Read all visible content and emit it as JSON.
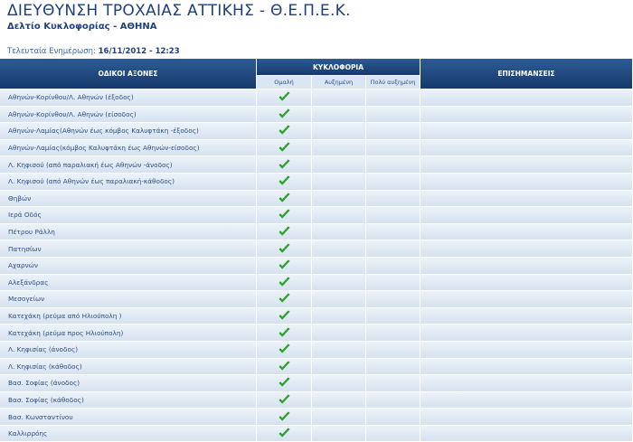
{
  "header": {
    "title": "ΔΙΕΥΘΥΝΣΗ ΤΡΟΧΑΙΑΣ ΑΤΤΙΚΗΣ - Θ.Ε.Π.Ε.Κ.",
    "subtitle": "Δελτίο Κυκλοφορίας - ΑΘΗΝΑ",
    "updated_label": "Τελευταία Ενημέρωση:",
    "updated_value": "16/11/2012 - 12:23"
  },
  "table": {
    "col_roads": "ΟΔΙΚΟΙ ΑΞΟΝΕΣ",
    "col_traffic": "ΚΥΚΛΟΦΟΡΙΑ",
    "col_notes": "ΕΠΙΣΗΜΑΝΣΕΙΣ",
    "traffic_levels": [
      "Ομαλή",
      "Αυξημένη",
      "Πολύ αυξημένη"
    ],
    "rows": [
      {
        "road": "Αθηνών-Κορίνθου/Λ. Αθηνών (έξοδος)",
        "status": "Ομαλή"
      },
      {
        "road": "Αθηνών-Κορίνθου/Λ. Αθηνών (είσοδος)",
        "status": "Ομαλή"
      },
      {
        "road": "Αθηνών-Λαμίας(Αθηνών έως κόμβος Καλυφτάκη -έξοδος)",
        "status": "Ομαλή"
      },
      {
        "road": "Αθηνών-Λαμίας(κόμβος Καλυφτάκη έως Αθηνών-είσοδος)",
        "status": "Ομαλή"
      },
      {
        "road": "Λ. Κηφισού (από παραλιακή έως Αθηνών -άνοδος)",
        "status": "Ομαλή"
      },
      {
        "road": "Λ. Κηφισού (από Αθηνών έως παραλιακή-κάθοδος)",
        "status": "Ομαλή"
      },
      {
        "road": "Θηβών",
        "status": "Ομαλή"
      },
      {
        "road": "Ιερά Οδός",
        "status": "Ομαλή"
      },
      {
        "road": "Πέτρου Ράλλη",
        "status": "Ομαλή"
      },
      {
        "road": "Πατησίων",
        "status": "Ομαλή"
      },
      {
        "road": "Αχαρνών",
        "status": "Ομαλή"
      },
      {
        "road": "Αλεξάνδρας",
        "status": "Ομαλή"
      },
      {
        "road": "Μεσογείων",
        "status": "Ομαλή"
      },
      {
        "road": "Κατεχάκη (ρεύμα από Ηλιούπολη )",
        "status": "Ομαλή"
      },
      {
        "road": "Κατεχάκη (ρεύμα προς Ηλιούπολη)",
        "status": "Ομαλή"
      },
      {
        "road": "Λ. Κηφισίας (άνοδος)",
        "status": "Ομαλή"
      },
      {
        "road": "Λ. Κηφισίας (κάθοδος)",
        "status": "Ομαλή"
      },
      {
        "road": "Βασ. Σοφίας (άνοδος)",
        "status": "Ομαλή"
      },
      {
        "road": "Βασ. Σοφίας (κάθοδος)",
        "status": "Ομαλή"
      },
      {
        "road": "Βασ. Κωνσταντίνου",
        "status": "Ομαλή"
      },
      {
        "road": "Καλλιρρόης",
        "status": "Ομαλή"
      }
    ]
  },
  "colors": {
    "title": "#1f3f7f",
    "header_bg": "#1e4577",
    "row_bg": "#e2eaf5",
    "check": "#2db82a"
  },
  "icons": {
    "status": "green-checkmark-icon"
  }
}
